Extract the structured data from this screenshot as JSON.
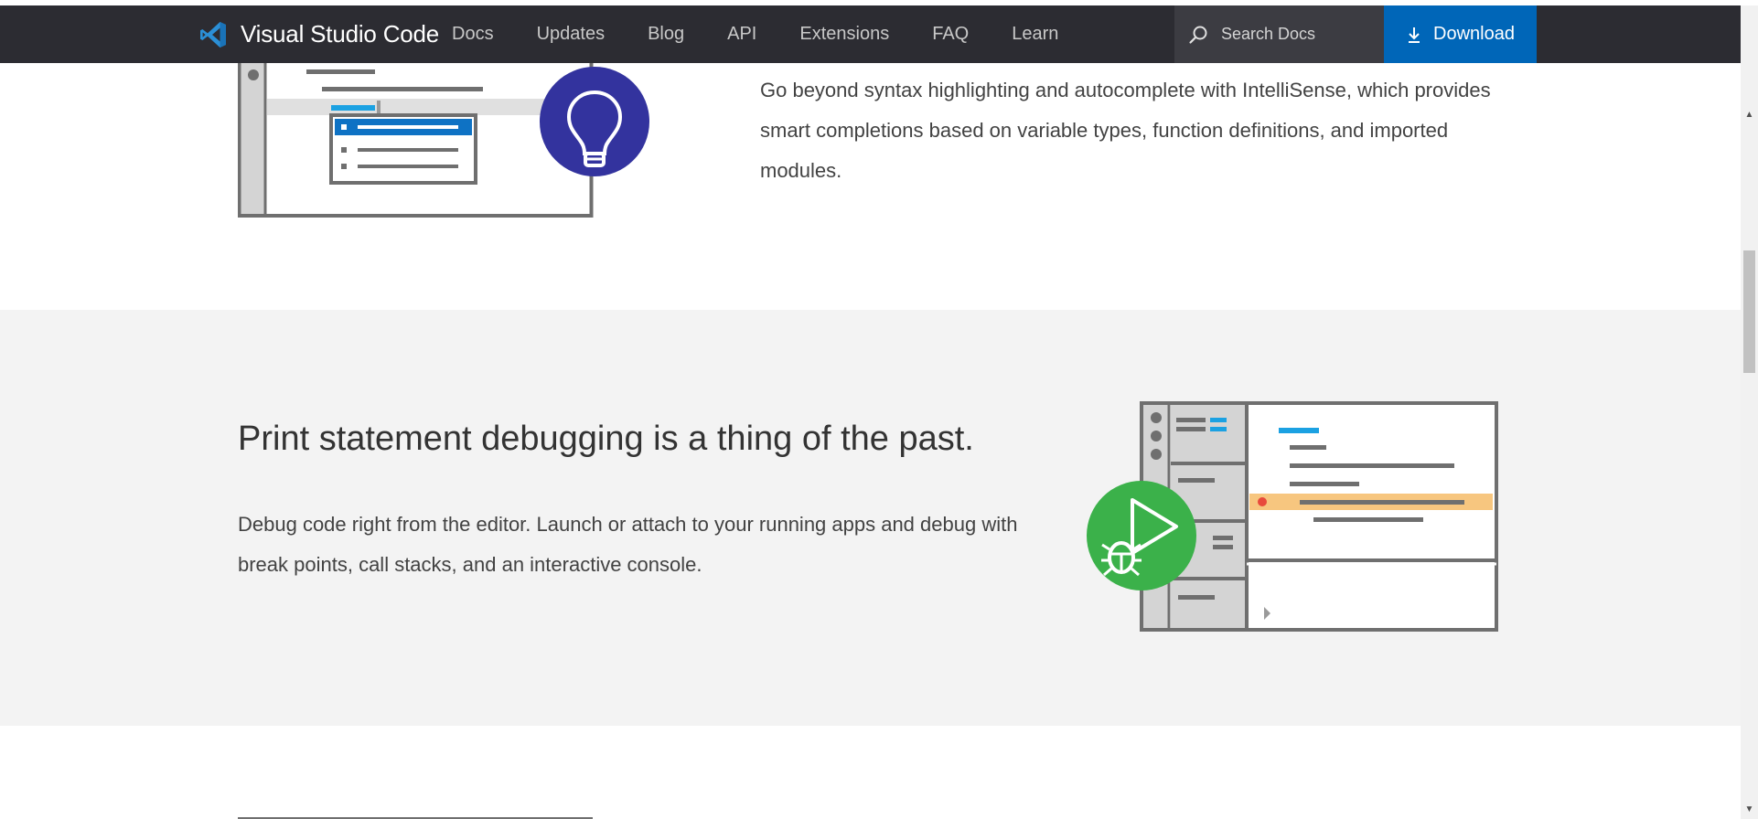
{
  "nav": {
    "brand": "Visual Studio Code",
    "links": [
      "Docs",
      "Updates",
      "Blog",
      "API",
      "Extensions",
      "FAQ",
      "Learn"
    ],
    "search_placeholder": "Search Docs",
    "download_label": "Download"
  },
  "intellisense": {
    "text": "Go beyond syntax highlighting and autocomplete with IntelliSense, which provides smart completions based on variable types, function definitions, and imported modules."
  },
  "debugging": {
    "title": "Print statement debugging is a thing of the past.",
    "text": "Debug code right from the editor. Launch or attach to your running apps and debug with break points, call stacks, and an interactive console."
  },
  "colors": {
    "nav_bg": "#2c2c32",
    "download_bg": "#0066b8",
    "intellisense_badge": "#33339e",
    "debug_badge": "#3bb14a",
    "highlight_line": "#f7c67f",
    "breakpoint": "#e84a3c",
    "code_accent": "#1ba1e2"
  },
  "icons": [
    "vscode-logo-icon",
    "search-icon",
    "download-icon",
    "lightbulb-icon",
    "bug-play-icon",
    "chevron-right-icon"
  ]
}
